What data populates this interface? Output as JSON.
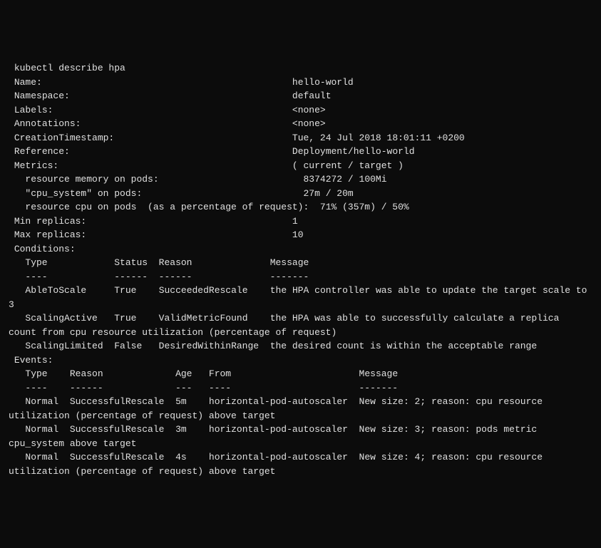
{
  "command": "kubectl describe hpa",
  "fields": {
    "name_label": "Name:",
    "name_value": "hello-world",
    "namespace_label": "Namespace:",
    "namespace_value": "default",
    "labels_label": "Labels:",
    "labels_value": "<none>",
    "annotations_label": "Annotations:",
    "annotations_value": "<none>",
    "creation_label": "CreationTimestamp:",
    "creation_value": "Tue, 24 Jul 2018 18:01:11 +0200",
    "reference_label": "Reference:",
    "reference_value": "Deployment/hello-world",
    "metrics_label": "Metrics:",
    "metrics_value": "( current / target )",
    "metric1_label": "  resource memory on pods:",
    "metric1_value": "8374272 / 100Mi",
    "metric2_label": "  \"cpu_system\" on pods:",
    "metric2_value": "27m / 20m",
    "metric3_label": "  resource cpu on pods  (as a percentage of request):",
    "metric3_value": "71% (357m) / 50%",
    "min_replicas_label": "Min replicas:",
    "min_replicas_value": "1",
    "max_replicas_label": "Max replicas:",
    "max_replicas_value": "10",
    "conditions_label": "Conditions:"
  },
  "conditions_header": {
    "type": "Type",
    "status": "Status",
    "reason": "Reason",
    "message": "Message"
  },
  "conditions": [
    {
      "type": "AbleToScale",
      "status": "True",
      "reason": "SucceededRescale",
      "message": "the HPA controller was able to update the target scale to 3"
    },
    {
      "type": "ScalingActive",
      "status": "True",
      "reason": "ValidMetricFound",
      "message": "the HPA was able to successfully calculate a replica count from cpu resource utilization (percentage of request)"
    },
    {
      "type": "ScalingLimited",
      "status": "False",
      "reason": "DesiredWithinRange",
      "message": "the desired count is within the acceptable range"
    }
  ],
  "events_label": "Events:",
  "events_header": {
    "type": "Type",
    "reason": "Reason",
    "age": "Age",
    "from": "From",
    "message": "Message"
  },
  "events": [
    {
      "type": "Normal",
      "reason": "SuccessfulRescale",
      "age": "5m",
      "from": "horizontal-pod-autoscaler",
      "message": "New size: 2; reason: cpu resource utilization (percentage of request) above target"
    },
    {
      "type": "Normal",
      "reason": "SuccessfulRescale",
      "age": "3m",
      "from": "horizontal-pod-autoscaler",
      "message": "New size: 3; reason: pods metric cpu_system above target"
    },
    {
      "type": "Normal",
      "reason": "SuccessfulRescale",
      "age": "4s",
      "from": "horizontal-pod-autoscaler",
      "message": "New size: 4; reason: cpu resource utilization (percentage of request) above target"
    }
  ]
}
